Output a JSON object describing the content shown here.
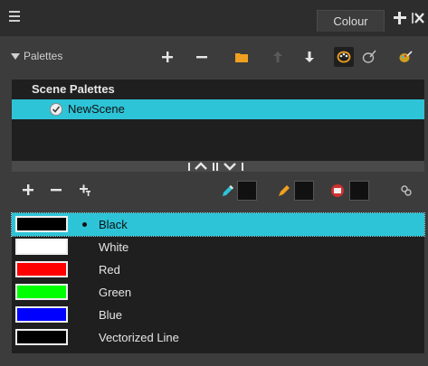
{
  "header": {
    "tab_label": "Colour"
  },
  "palettes": {
    "section_label": "Palettes",
    "list_header": "Scene Palettes",
    "items": [
      {
        "name": "NewScene",
        "selected": true
      }
    ]
  },
  "colours": {
    "items": [
      {
        "name": "Black",
        "color": "#000000",
        "selected": true
      },
      {
        "name": "White",
        "color": "#ffffff",
        "selected": false
      },
      {
        "name": "Red",
        "color": "#ff0000",
        "selected": false
      },
      {
        "name": "Green",
        "color": "#00ff00",
        "selected": false
      },
      {
        "name": "Blue",
        "color": "#0000ff",
        "selected": false
      },
      {
        "name": "Vectorized Line",
        "color": "#000000",
        "selected": false
      }
    ]
  },
  "theme": {
    "accent": "#2ec4d8",
    "panel_bg": "#3c3c3c",
    "list_bg": "#1f1f1f"
  }
}
